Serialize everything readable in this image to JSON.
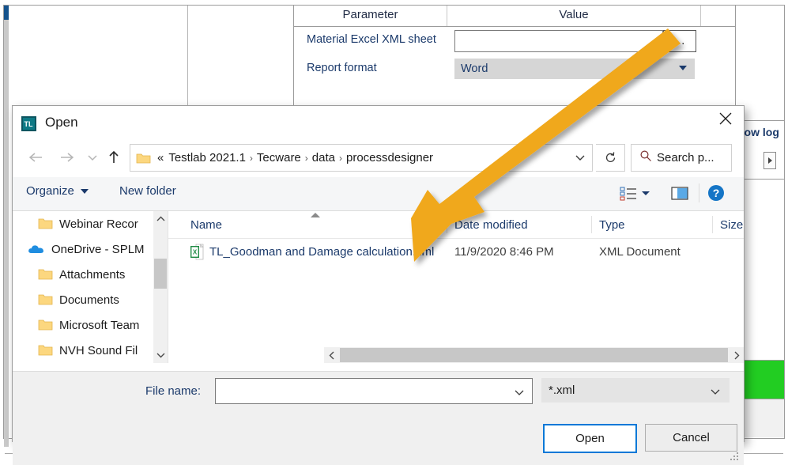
{
  "background": {
    "param_table": {
      "headers": [
        "Parameter",
        "Value"
      ],
      "rows": [
        {
          "label": "Material Excel XML sheet",
          "value": "",
          "browse_label": "…",
          "control": "text-with-browse"
        },
        {
          "label": "Report format",
          "value": "Word",
          "control": "dropdown"
        }
      ]
    },
    "right_panel": {
      "show_log_label": "how log",
      "status_color": "#22cd22"
    },
    "brand_text": "Tecware"
  },
  "dialog": {
    "title": "Open",
    "app_icon": "tl-app-icon",
    "close_label": "close-icon",
    "nav": {
      "back": "back-arrow-icon",
      "forward": "forward-arrow-icon",
      "recent": "recent-locations-icon",
      "up": "up-arrow-icon",
      "breadcrumb_prefix": "«",
      "breadcrumbs": [
        "Testlab 2021.1",
        "Tecware",
        "data",
        "processdesigner"
      ],
      "breadcrumb_separator": "›",
      "address_dropdown": "chevron-down-icon",
      "refresh": "refresh-icon",
      "search_placeholder": "Search p..."
    },
    "commandbar": {
      "organize": "Organize",
      "new_folder": "New folder",
      "view_mode": "view-mode-icon",
      "preview_pane": "preview-pane-icon",
      "help": "?"
    },
    "nav_pane": {
      "items": [
        {
          "label": "Webinar Recor",
          "icon": "folder-icon",
          "level": "child"
        },
        {
          "label": "OneDrive - SPLM",
          "icon": "onedrive-cloud-icon",
          "level": "root"
        },
        {
          "label": "Attachments",
          "icon": "folder-icon",
          "level": "child"
        },
        {
          "label": "Documents",
          "icon": "folder-icon",
          "level": "child"
        },
        {
          "label": "Microsoft Team",
          "icon": "folder-icon",
          "level": "child"
        },
        {
          "label": "NVH Sound Fil",
          "icon": "folder-icon",
          "level": "child"
        }
      ],
      "scroll_up": "▲",
      "scroll_down": "▼"
    },
    "file_list": {
      "columns": [
        "Name",
        "Date modified",
        "Type",
        "Size"
      ],
      "sorted_by": "Name",
      "rows": [
        {
          "name": "TL_Goodman and Damage calculation.xml",
          "date_modified": "11/9/2020 8:46 PM",
          "type": "XML Document",
          "size": "",
          "icon": "xml-excel-file-icon"
        }
      ],
      "hscroll_left": "‹",
      "hscroll_right": "›"
    },
    "footer": {
      "filename_label": "File name:",
      "filename_value": "",
      "filetype_value": "*.xml",
      "open_button": "Open",
      "cancel_button": "Cancel"
    }
  },
  "annotation": {
    "arrow_color": "#F0A81E",
    "arrow_name": "pointer-arrow"
  }
}
